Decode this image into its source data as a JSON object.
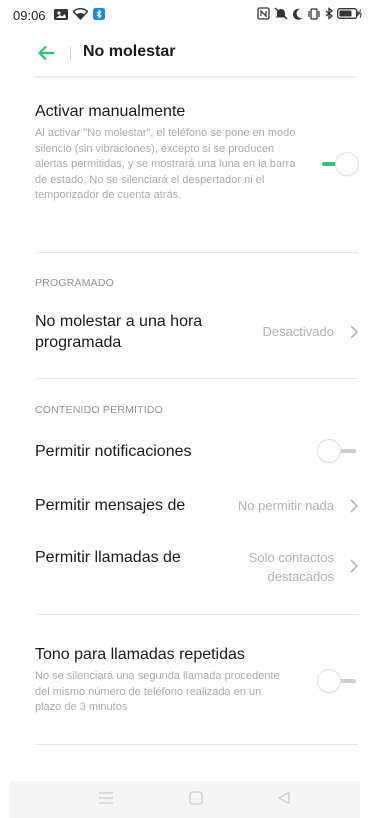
{
  "status_bar": {
    "time": "09:06",
    "icons_left": [
      "gallery-icon",
      "wifi-icon",
      "bluetooth-app-icon"
    ],
    "icons_right": [
      "nfc-icon",
      "mute-icon",
      "moon-icon",
      "vibrate-icon",
      "bluetooth-icon",
      "battery-icon"
    ]
  },
  "header": {
    "title": "No molestar",
    "back_icon": "arrow-left-icon"
  },
  "manual": {
    "title": "Activar manualmente",
    "description": "Al activar \"No molestar\", el teléfono se pone en modo silencio (sin vibraciones), excepto si se producen alertas permitidas, y se mostrará una luna en la barra de estado. No se silenciará el despertador ni el temporizador de cuenta atrás.",
    "enabled": true
  },
  "scheduled": {
    "header": "PROGRAMADO",
    "item": {
      "title": "No molestar a una hora programada",
      "value": "Desactivado"
    }
  },
  "allowed": {
    "header": "CONTENIDO PERMITIDO",
    "notifications": {
      "title": "Permitir notificaciones",
      "enabled": false
    },
    "messages": {
      "title": "Permitir mensajes de",
      "value": "No permitir nada"
    },
    "calls": {
      "title": "Permitir llamadas de",
      "value": "Solo contactos destacados"
    }
  },
  "repeat_calls": {
    "title": "Tono para llamadas repetidas",
    "description": "No se silenciará una segunda llamada procedente del mismo número de teléfono realizada en un plazo de 3 minutos",
    "enabled": false
  },
  "colors": {
    "accent": "#2dc46e",
    "secondary_text": "#a9a9a9",
    "section_header": "#8f8f8f"
  },
  "nav_bar": {
    "icons": [
      "menu-icon",
      "home-icon",
      "back-triangle-icon"
    ]
  }
}
